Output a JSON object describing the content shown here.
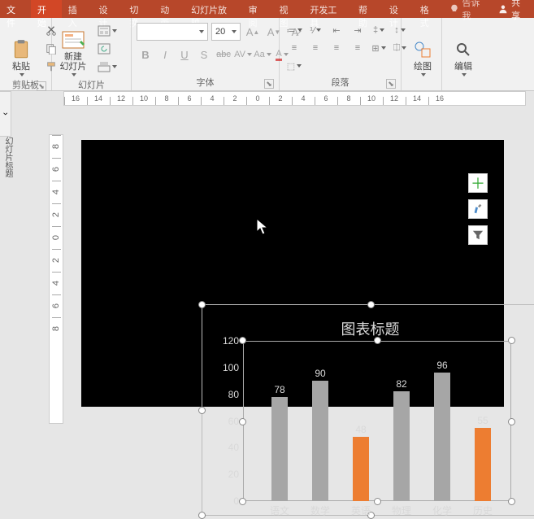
{
  "tabs": {
    "file": "文件",
    "start": "开始",
    "insert": "插入",
    "design": "设计",
    "transition": "切换",
    "animation": "动画",
    "slideshow": "幻灯片放映",
    "review": "审阅",
    "view": "视图",
    "dev": "开发工具",
    "help": "帮助",
    "design2": "设计",
    "format": "格式",
    "tellme": "告诉我"
  },
  "share": "共享",
  "groups": {
    "clipboard": "剪贴板",
    "slides": "幻灯片",
    "font": "字体",
    "paragraph": "段落",
    "drawing": "绘图",
    "editing": "编辑"
  },
  "buttons": {
    "paste": "粘贴",
    "newslide": "新建\n幻灯片",
    "draw": "绘图",
    "edit": "编辑",
    "layout": "",
    "reset": "",
    "section": ""
  },
  "font": {
    "size": "20",
    "bold": "B",
    "italic": "I",
    "underline": "U",
    "shadow": "S",
    "strike": "abc",
    "charspace": "AV",
    "case": "Aa"
  },
  "sidebar": "幻灯片标题",
  "ruler_h": [
    "16",
    "14",
    "12",
    "10",
    "8",
    "6",
    "4",
    "2",
    "0",
    "2",
    "4",
    "6",
    "8",
    "10",
    "12",
    "14",
    "16"
  ],
  "ruler_v": [
    "8",
    "6",
    "4",
    "2",
    "0",
    "2",
    "4",
    "6",
    "8"
  ],
  "chart_data": {
    "type": "bar",
    "title": "图表标题",
    "categories": [
      "语文",
      "数学",
      "英语",
      "物理",
      "化学",
      "历史"
    ],
    "values": [
      78,
      90,
      48,
      82,
      96,
      55
    ],
    "accent_idx": [
      2,
      5
    ],
    "ylim": [
      0,
      120
    ],
    "yticks": [
      0,
      20,
      40,
      60,
      80,
      100,
      120
    ]
  },
  "float": {
    "plus": "＋",
    "brush": "brush",
    "filter": "filter"
  }
}
